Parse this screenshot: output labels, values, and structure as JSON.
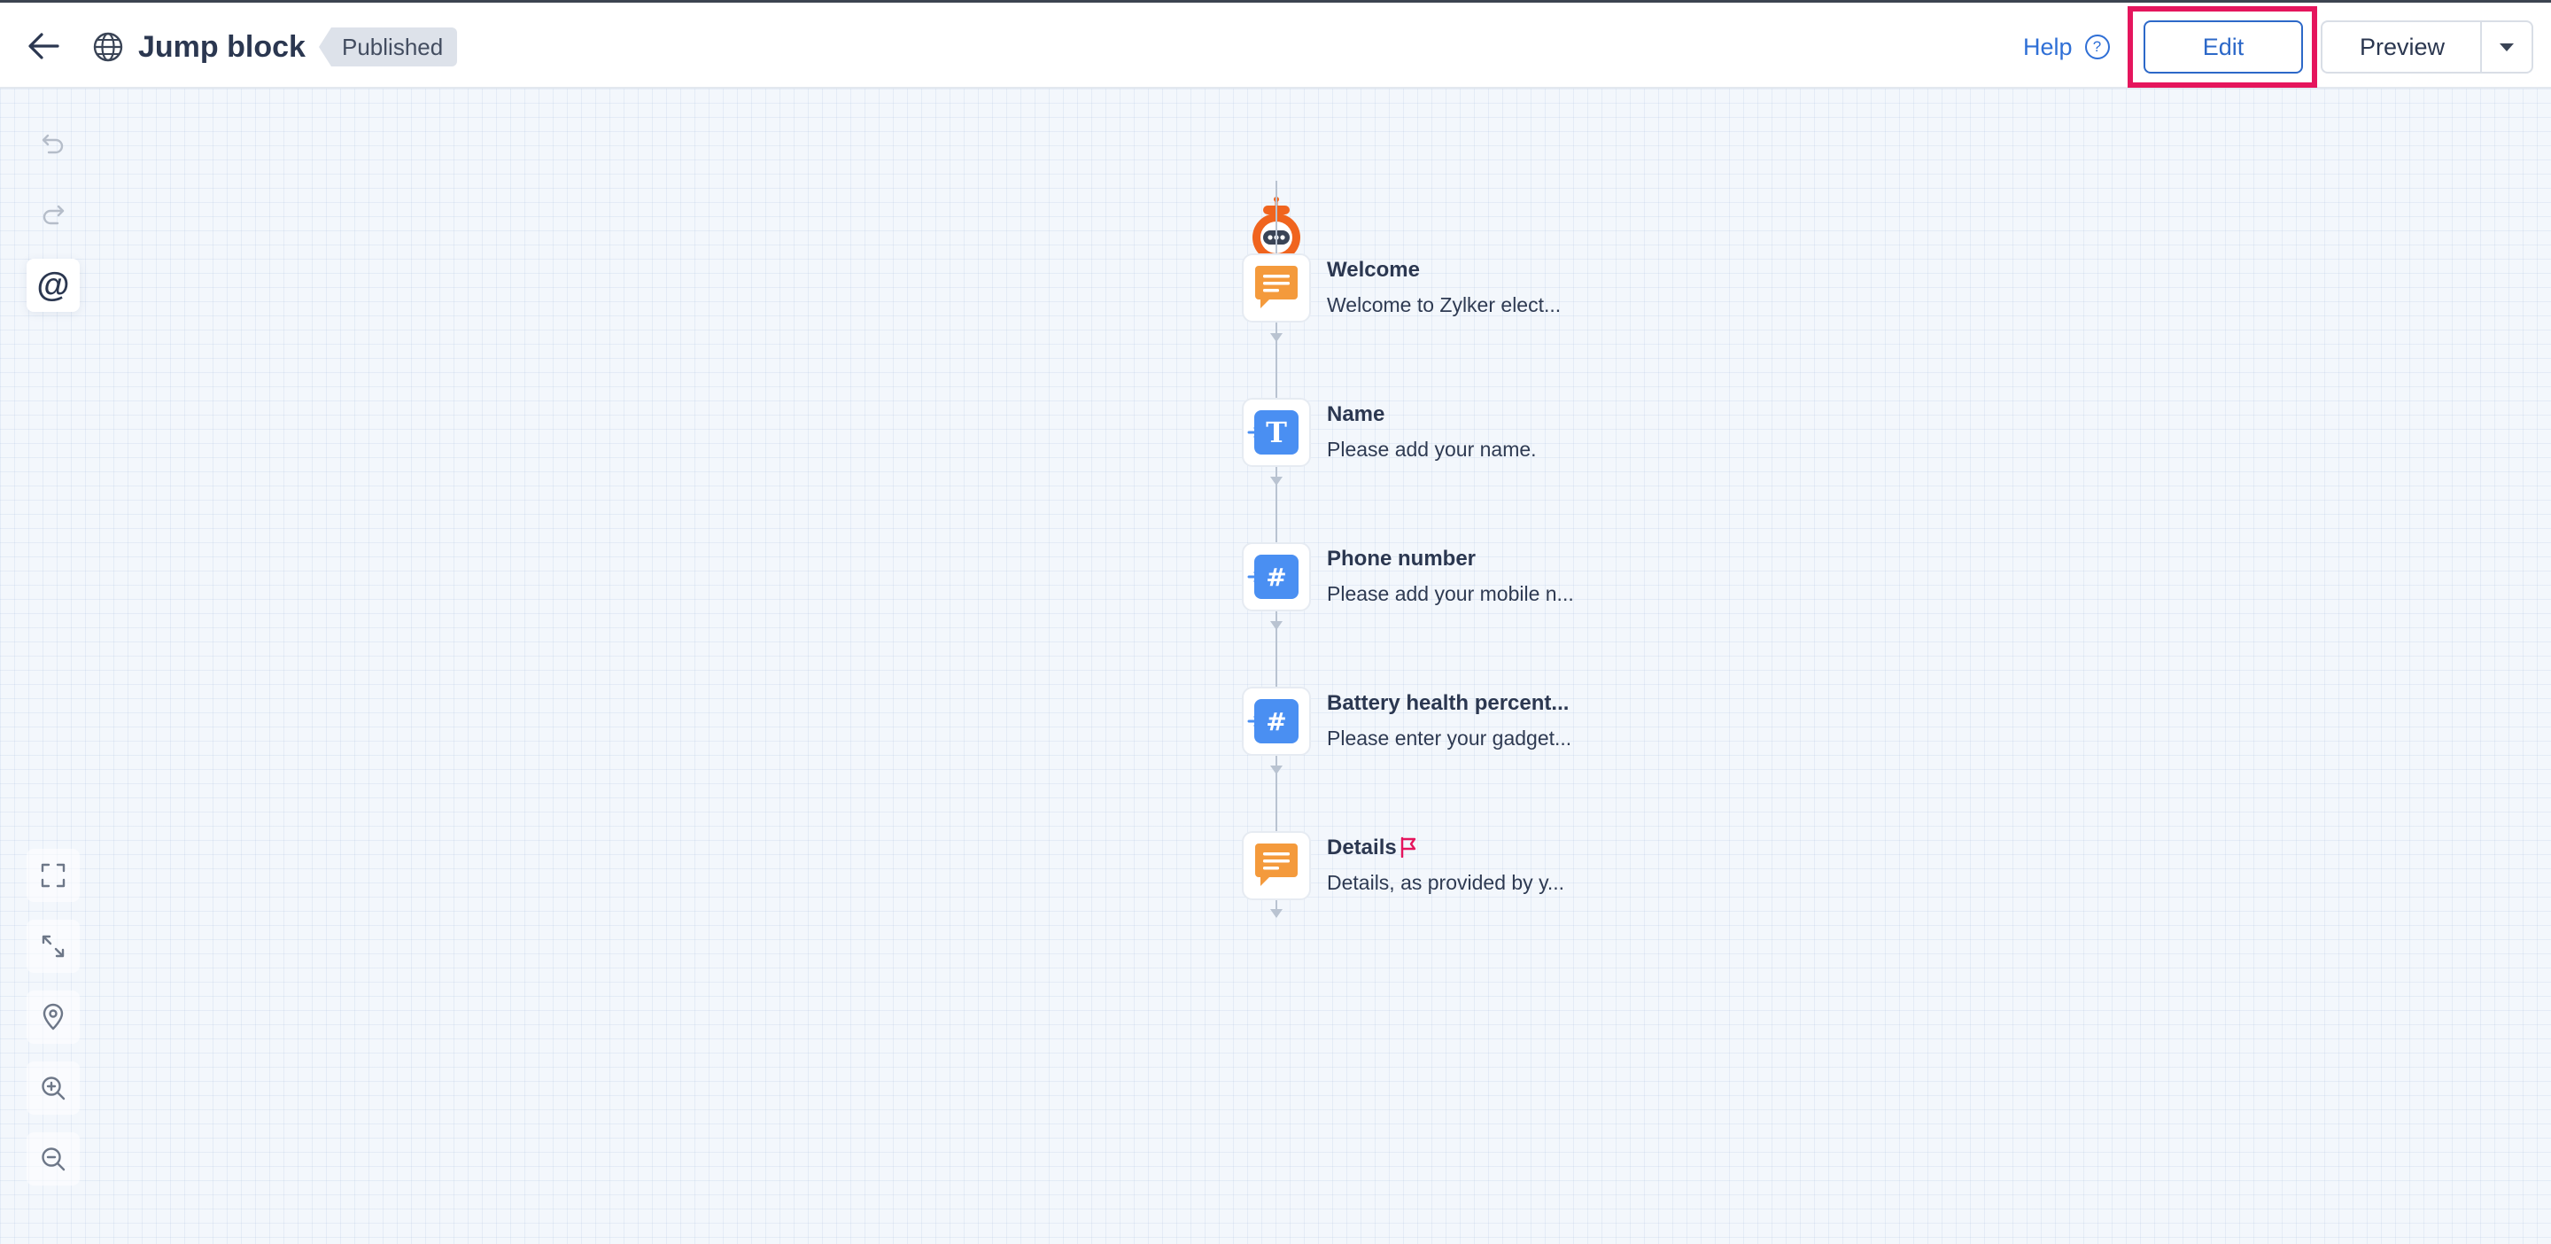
{
  "header": {
    "title": "Jump block",
    "status": "Published",
    "help_label": "Help",
    "help_icon_glyph": "?",
    "edit_label": "Edit",
    "preview_label": "Preview"
  },
  "icons": {
    "back": "arrow-left-icon",
    "globe": "globe-icon",
    "help": "question-circle-icon",
    "dropdown": "caret-down-icon",
    "undo": "undo-icon",
    "redo": "redo-icon",
    "mention": "at-sign-icon",
    "fit_screen": "fullscreen-icon",
    "expand": "expand-icon",
    "locate": "map-pin-icon",
    "zoom_in": "zoom-in-icon",
    "zoom_out": "zoom-out-icon",
    "bot": "bot-avatar-icon",
    "message": "chat-message-icon",
    "text_input": "text-input-icon",
    "number_input": "number-input-icon",
    "end_flag": "flag-icon"
  },
  "toolbar": {
    "mention_glyph": "@"
  },
  "flow": {
    "nodes": [
      {
        "title": "Welcome",
        "description": "Welcome to Zylker elect...",
        "kind": "message"
      },
      {
        "title": "Name",
        "description": "Please add your name.",
        "kind": "text",
        "glyph": "T"
      },
      {
        "title": "Phone number",
        "description": "Please add your mobile n...",
        "kind": "number",
        "glyph": "#"
      },
      {
        "title": "Battery health percent...",
        "description": "Please enter your gadget...",
        "kind": "number",
        "glyph": "#"
      },
      {
        "title": "Details",
        "description": "Details, as provided by y...",
        "kind": "message",
        "flagged": true
      }
    ]
  },
  "colors": {
    "accent_blue": "#2c68c8",
    "highlight_pink": "#e5155d",
    "message_orange": "#f49a3c",
    "input_blue": "#4a8ff2",
    "bot_orange": "#f0641e",
    "flag_red": "#e5155d"
  }
}
